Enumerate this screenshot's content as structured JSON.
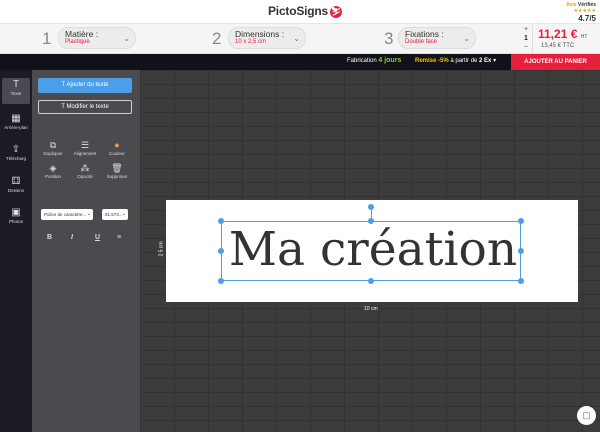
{
  "header": {
    "logo": "PictoSigns",
    "logo_mark": "⛷",
    "rating_brand_a": "Avis",
    "rating_brand_b": "Vérifiés",
    "rating_stars": "★★★★★",
    "rating_score": "4.7/5"
  },
  "options": [
    {
      "step": "1",
      "title": "Matière :",
      "value": "Plastique"
    },
    {
      "step": "2",
      "title": "Dimensions :",
      "value": "10 x 2.5 cm"
    },
    {
      "step": "3",
      "title": "Fixations :",
      "value": "Double face"
    }
  ],
  "quantity": {
    "plus": "+",
    "value": "1",
    "minus": "−"
  },
  "price": {
    "ht": "11,21 €",
    "ht_suffix": "HT",
    "ttc": "13,45 € TTC"
  },
  "bar": {
    "fabrication_label": "Fabrication",
    "fabrication_value": "4 jours",
    "remise_highlight": "Remise -5%",
    "remise_text": "à partir de",
    "remise_qty": "2 Ex",
    "cart_button": "AJOUTER AU PANIER"
  },
  "rail": [
    {
      "label": "Texte",
      "icon": "T"
    },
    {
      "label": "Arrière-plan",
      "icon": "▦"
    },
    {
      "label": "Télécharg",
      "icon": "⇪"
    },
    {
      "label": "Dessins",
      "icon": "⚃"
    },
    {
      "label": "Photos",
      "icon": "▣"
    }
  ],
  "panel": {
    "add_text": "Ajouter du texte",
    "edit_text": "Modifier le texte",
    "tools": [
      {
        "label": "Dupliquer",
        "icon": "⧉"
      },
      {
        "label": "Alignement",
        "icon": "☰"
      },
      {
        "label": "Couleur",
        "icon": "●"
      },
      {
        "label": "Position",
        "icon": "◈"
      },
      {
        "label": "Opacité",
        "icon": "⁂"
      },
      {
        "label": "Supprimer",
        "icon": "🗑"
      }
    ],
    "font_select": "Police de caractère...",
    "size_select": "81.573...",
    "format": [
      "B",
      "I",
      "U",
      "≡"
    ]
  },
  "canvas": {
    "text": "Ma création",
    "width_label": "10 cm",
    "height_label": "2.5 cm"
  },
  "colors": {
    "accent": "#e5203a",
    "selection": "#4c9ee8",
    "green": "#8dc63f",
    "yellow": "#f5c400"
  }
}
